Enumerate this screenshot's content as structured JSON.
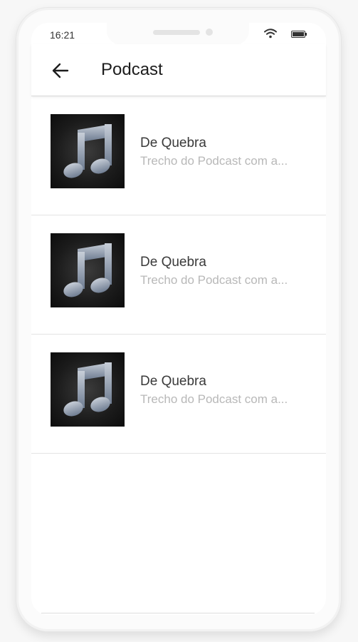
{
  "status_bar": {
    "time": "16:21"
  },
  "app_bar": {
    "title": "Podcast"
  },
  "list": {
    "items": [
      {
        "title": "De Quebra",
        "subtitle": "Trecho do Podcast com a..."
      },
      {
        "title": "De Quebra",
        "subtitle": "Trecho do Podcast com a..."
      },
      {
        "title": "De Quebra",
        "subtitle": "Trecho do Podcast com a..."
      }
    ]
  },
  "icons": {
    "back": "arrow-left-icon",
    "thumbnail": "music-note-icon",
    "wifi": "wifi-icon",
    "battery": "battery-icon"
  },
  "colors": {
    "background": "#ffffff",
    "title_text": "#3a3a3a",
    "subtitle_text": "#b8b8b8",
    "note_gradient": "#8a97aa"
  }
}
